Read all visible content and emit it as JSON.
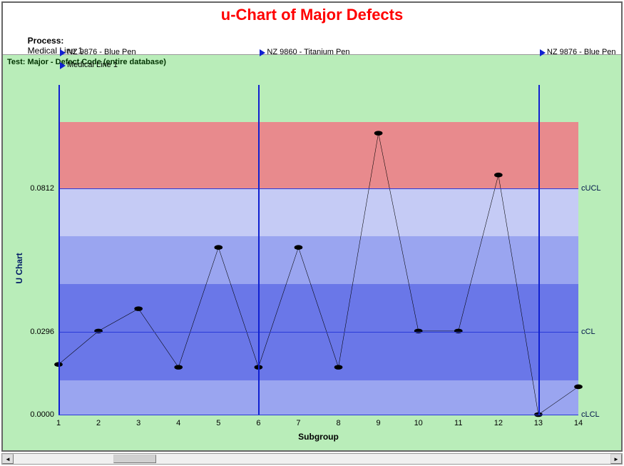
{
  "header": {
    "title": "u-Chart of Major Defects",
    "process_label": "Process:",
    "process_value": "Medical Line 1",
    "test_label": "Test:",
    "test_value": "Major"
  },
  "subtitle": "Test: Major - Defect Code (entire database)",
  "axes": {
    "ylabel": "U Chart",
    "xlabel": "Subgroup",
    "y_ticks": [
      "0.0812",
      "0.0296",
      "0.0000"
    ],
    "x_ticks": [
      "1",
      "2",
      "3",
      "4",
      "5",
      "6",
      "7",
      "8",
      "9",
      "10",
      "11",
      "12",
      "13",
      "14"
    ]
  },
  "limits": {
    "cUCL_label": "cUCL",
    "cCL_label": "cCL",
    "cLCL_label": "cLCL"
  },
  "flags": {
    "f1_line1": "NZ 9876 - Blue Pen",
    "f1_line2": "Medical Line 1",
    "f2_line1": "NZ 9860 - Titanium Pen",
    "f3_line1": "NZ 9876 - Blue Pen"
  },
  "chart_data": {
    "type": "line",
    "title": "u-Chart of Major Defects",
    "xlabel": "Subgroup",
    "ylabel": "U Chart",
    "x": [
      1,
      2,
      3,
      4,
      5,
      6,
      7,
      8,
      9,
      10,
      11,
      12,
      13,
      14
    ],
    "values": [
      0.018,
      0.03,
      0.038,
      0.017,
      0.06,
      0.017,
      0.06,
      0.017,
      0.101,
      0.03,
      0.03,
      0.086,
      0.0,
      0.01
    ],
    "cUCL": 0.0812,
    "cCL": 0.0296,
    "cLCL": 0.0,
    "ylim": [
      0.0,
      0.105
    ],
    "phase_markers": [
      {
        "x": 1,
        "labels": [
          "NZ 9876 - Blue Pen",
          "Medical Line 1"
        ]
      },
      {
        "x": 6,
        "labels": [
          "NZ 9860 - Titanium Pen"
        ]
      },
      {
        "x": 13,
        "labels": [
          "NZ 9876 - Blue Pen"
        ]
      }
    ]
  }
}
